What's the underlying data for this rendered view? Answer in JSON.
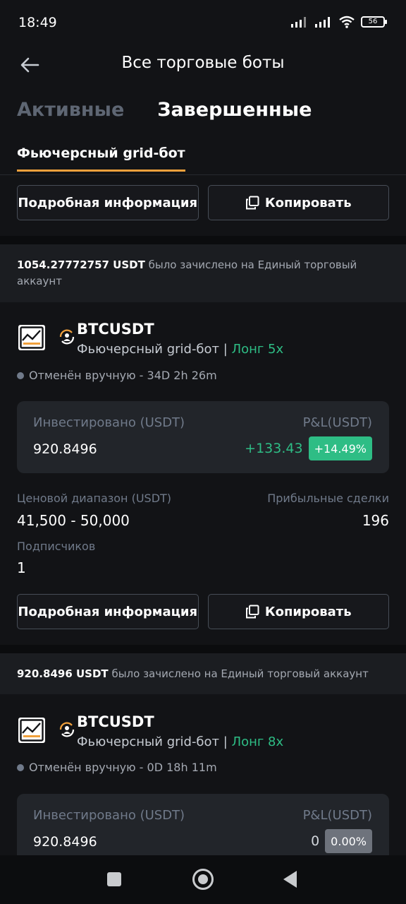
{
  "status_bar": {
    "time": "18:49",
    "battery": "56"
  },
  "header": {
    "title": "Все торговые боты"
  },
  "tabs": [
    {
      "label": "Активные",
      "active": false
    },
    {
      "label": "Завершенные",
      "active": true
    }
  ],
  "subtab": {
    "label": "Фьючерсный grid-бот"
  },
  "buttons": {
    "details": "Подробная информация",
    "copy": "Копировать"
  },
  "bots": [
    {
      "credit_amount": "1054.27772757 USDT",
      "credit_text": "было зачислено на Единый торговый аккаунт",
      "symbol": "BTCUSDT",
      "type": "Фьючерсный grid-бот",
      "direction": "Лонг 5x",
      "status": "Отменён вручную - 34D 2h 26m",
      "invested_label": "Инвестировано (USDT)",
      "invested": "920.8496",
      "pnl_label": "P&L(USDT)",
      "pnl": "+133.43",
      "pnl_pct": "+14.49%",
      "range_label": "Ценовой диапазон (USDT)",
      "range": "41,500 - 50,000",
      "deals_label": "Прибыльные сделки",
      "deals": "196",
      "subs_label": "Подписчиков",
      "subs": "1"
    },
    {
      "credit_amount": "920.8496 USDT",
      "credit_text": "было зачислено на Единый торговый аккаунт",
      "symbol": "BTCUSDT",
      "type": "Фьючерсный grid-бот",
      "direction": "Лонг 8x",
      "status": "Отменён вручную - 0D 18h 11m",
      "invested_label": "Инвестировано (USDT)",
      "invested": "920.8496",
      "pnl_label": "P&L(USDT)",
      "pnl": "0",
      "pnl_pct": "0.00%"
    }
  ],
  "colors": {
    "accent": "#f0a03c",
    "positive": "#2ebd85",
    "background": "#121316"
  }
}
